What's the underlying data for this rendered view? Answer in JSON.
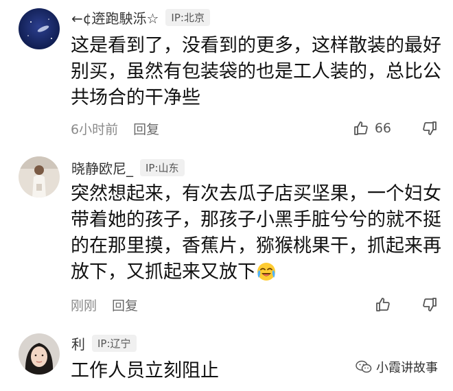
{
  "comments": [
    {
      "username": "←¢逩跑駚泺☆",
      "ip": "IP:北京",
      "text": "这是看到了，没看到的更多，这样散装的最好别买，虽然有包装袋的也是工人装的，总比公共场合的干净些",
      "time": "6小时前",
      "reply_label": "回复",
      "likes": "66"
    },
    {
      "username": "晓静欧尼_",
      "ip": "IP:山东",
      "text": "突然想起来，有次去瓜子店买坚果，一个妇女带着她的孩子，那孩子小黑手脏兮兮的就不挺的在那里摸，香蕉片，猕猴桃果干，抓起来再放下，又抓起来又放下",
      "time": "刚刚",
      "reply_label": "回复"
    },
    {
      "username": "利",
      "ip": "IP:辽宁",
      "text": "工作人员立刻阻止"
    }
  ],
  "watermark": {
    "text": "小霞讲故事"
  },
  "icons": {
    "like": "thumbs-up-icon",
    "dislike": "thumbs-down-icon",
    "emoji": "crying-laughing-emoji"
  },
  "colors": {
    "text": "#111111",
    "meta": "#8a8a8a",
    "badge_bg": "#f0f0f0"
  }
}
